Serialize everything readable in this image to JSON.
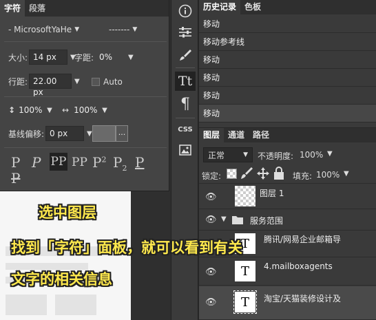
{
  "character_panel": {
    "tabs": [
      "字符",
      "段落"
    ],
    "font_family": "- MicrosoftYaHe",
    "font_style": "-------",
    "size_label": "大小:",
    "size_value": "14 px",
    "tracking_label": "字距:",
    "tracking_value": "0%",
    "leading_label": "行距:",
    "leading_value": "22.00 px",
    "auto_label": "Auto",
    "vscale_value": "100%",
    "hscale_value": "100%",
    "baseline_label": "基线偏移:",
    "baseline_value": "0 px",
    "color_more": "...",
    "glyph_regular": "P",
    "glyph_italic": "P",
    "glyph_caps": "PP",
    "glyph_smallcaps": "PP",
    "glyph_super": "P",
    "glyph_super_mark": "2",
    "glyph_sub": "P",
    "glyph_sub_mark": "2",
    "glyph_underline": "P",
    "glyph_strike": "P"
  },
  "tools": {
    "info_icon": "i",
    "type_icon": "Tt",
    "paragraph_icon": "¶",
    "css_label": "CSS"
  },
  "history_panel": {
    "tabs": [
      "历史记录",
      "色板"
    ],
    "items": [
      "移动",
      "移动参考线",
      "移动",
      "移动",
      "移动",
      "移动"
    ]
  },
  "layers_panel": {
    "tabs": [
      "图层",
      "通道",
      "路径"
    ],
    "blend_mode": "正常",
    "opacity_label": "不透明度:",
    "opacity_value": "100%",
    "lock_label": "锁定:",
    "fill_label": "填充:",
    "fill_value": "100%",
    "layers": [
      {
        "name": "图层 1",
        "type": "raster"
      },
      {
        "name": "服务范围",
        "type": "group"
      },
      {
        "name": "腾讯/网易企业邮箱导",
        "type": "text"
      },
      {
        "name": "4.mailboxagents",
        "type": "text"
      },
      {
        "name": "淘宝/天猫装修设计及",
        "type": "text"
      }
    ],
    "text_thumb": "T"
  },
  "annotations": {
    "line1": "选中图层",
    "line2": "找到「字符」面板，就可以看到有关",
    "line3": "文字的相关信息"
  },
  "colors": {
    "annotation": "#ffe94d",
    "panel": "#444444",
    "panel_dark": "#2f2f2f"
  }
}
